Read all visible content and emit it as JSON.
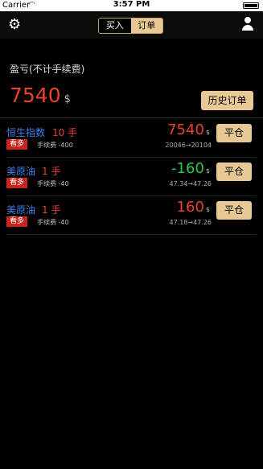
{
  "status_bar": {
    "carrier": "Carrier",
    "time": "3:57 PM"
  },
  "nav": {
    "settings_icon": "gear-icon",
    "tab_buy": "买入",
    "tab_orders": "订单",
    "user_icon": "user-icon"
  },
  "summary": {
    "label": "盈亏(不计手续费)",
    "value": "7540",
    "unit": "$",
    "history_button": "历史订单"
  },
  "positions": [
    {
      "name": "恒生指数",
      "lots": "10 手",
      "direction": "看多",
      "fee": "手续费 -400",
      "pl": "7540",
      "pl_color": "#e8412f",
      "unit": "$",
      "range": "20046→20104",
      "close_label": "平仓"
    },
    {
      "name": "美原油",
      "lots": "1 手",
      "direction": "看多",
      "fee": "手续费 -40",
      "pl": "-160",
      "pl_color": "#28c841",
      "unit": "$",
      "range": "47.34→47.26",
      "close_label": "平仓"
    },
    {
      "name": "美原油",
      "lots": "1 手",
      "direction": "看多",
      "fee": "手续费 -40",
      "pl": "160",
      "pl_color": "#e8412f",
      "unit": "$",
      "range": "47.18→47.26",
      "close_label": "平仓"
    }
  ],
  "colors": {
    "accent_gold": "#e8c996",
    "profit_red": "#e8412f",
    "loss_green": "#28c841",
    "name_blue": "#3f7fe6"
  }
}
